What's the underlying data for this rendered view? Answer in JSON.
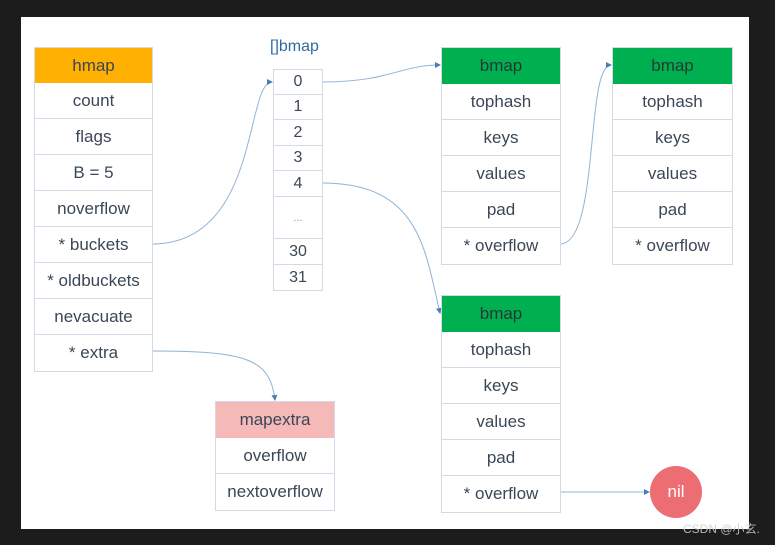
{
  "hmap": {
    "title": "hmap",
    "color": "#ffb000",
    "fields": [
      "count",
      "flags",
      "B = 5",
      "noverflow",
      "* buckets",
      "* oldbuckets",
      "nevacuate",
      "* extra"
    ]
  },
  "bucket_array": {
    "title": "[]bmap",
    "items": [
      "0",
      "1",
      "2",
      "3",
      "4",
      "...",
      "30",
      "31"
    ]
  },
  "bmap_boxes": [
    {
      "title": "bmap",
      "color": "#00b050",
      "fields": [
        "tophash",
        "keys",
        "values",
        "pad",
        "* overflow"
      ]
    },
    {
      "title": "bmap",
      "color": "#00b050",
      "fields": [
        "tophash",
        "keys",
        "values",
        "pad",
        "* overflow"
      ]
    },
    {
      "title": "bmap",
      "color": "#00b050",
      "fields": [
        "tophash",
        "keys",
        "values",
        "pad",
        "* overflow"
      ]
    }
  ],
  "mapextra": {
    "title": "mapextra",
    "color": "#f5b9b8",
    "fields": [
      "overflow",
      "nextoverflow"
    ]
  },
  "nil": {
    "label": "nil",
    "color": "#ec6d72"
  },
  "watermark": "CSDN @小玄."
}
